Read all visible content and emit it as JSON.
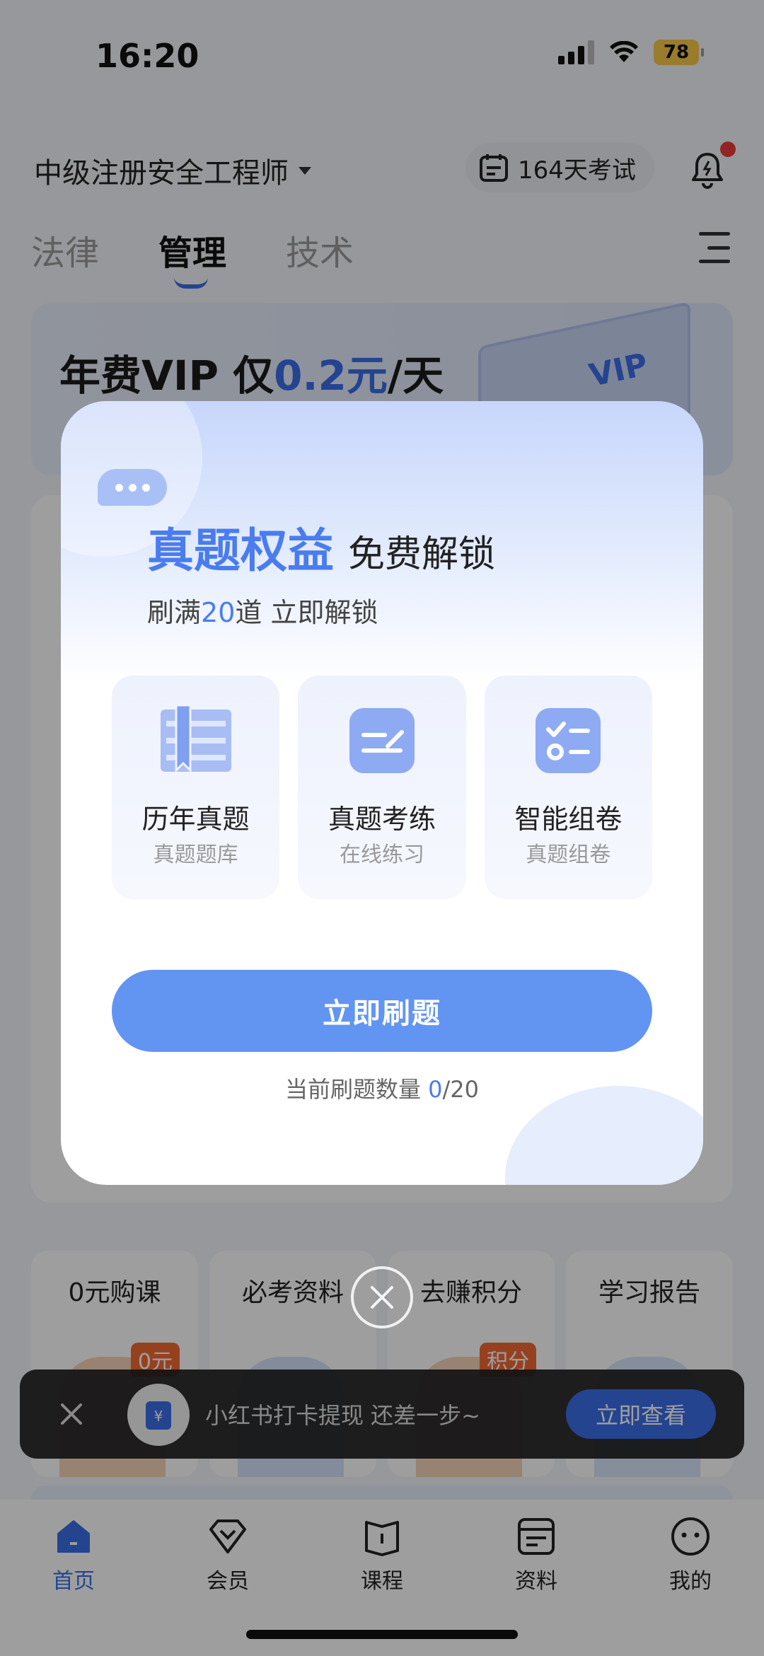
{
  "status_bar": {
    "time": "16:20",
    "battery": "78"
  },
  "header": {
    "title": "中级注册安全工程师",
    "exam_countdown": "164天考试"
  },
  "tabs": [
    {
      "label": "法律",
      "active": false
    },
    {
      "label": "管理",
      "active": true
    },
    {
      "label": "技术",
      "active": false
    }
  ],
  "banner": {
    "prefix": "年费VIP  仅",
    "price": "0.2元",
    "suffix": "/天",
    "art_label": "VIP"
  },
  "background": {
    "left_label": "",
    "right_label": ""
  },
  "quick_links": [
    {
      "label": "0元购课",
      "badge": "0元"
    },
    {
      "label": "必考资料",
      "badge": ""
    },
    {
      "label": "去赚积分",
      "badge": "积分"
    },
    {
      "label": "学习报告",
      "badge": ""
    }
  ],
  "toast": {
    "text": "小红书打卡提现  还差一步~",
    "button": "立即查看"
  },
  "modal": {
    "title_highlight": "真题权益",
    "title_rest": "免费解锁",
    "subtitle_prefix": "刷满",
    "subtitle_count": "20",
    "subtitle_suffix": "道 立即解锁",
    "features": [
      {
        "title": "历年真题",
        "subtitle": "真题题库",
        "icon": "book-icon"
      },
      {
        "title": "真题考练",
        "subtitle": "在线练习",
        "icon": "practice-icon"
      },
      {
        "title": "智能组卷",
        "subtitle": "真题组卷",
        "icon": "checklist-icon"
      }
    ],
    "cta": "立即刷题",
    "progress_label": "当前刷题数量 ",
    "progress_current": "0",
    "progress_total": "/20"
  },
  "tabbar": [
    {
      "label": "首页",
      "active": true,
      "icon": "home-icon"
    },
    {
      "label": "会员",
      "active": false,
      "icon": "diamond-icon"
    },
    {
      "label": "课程",
      "active": false,
      "icon": "book-open-icon"
    },
    {
      "label": "资料",
      "active": false,
      "icon": "document-icon"
    },
    {
      "label": "我的",
      "active": false,
      "icon": "profile-icon"
    }
  ],
  "colors": {
    "accent": "#3b6fe8",
    "cta": "#6294f2",
    "title_highlight": "#4a7cf0",
    "badge": "#f06a35"
  }
}
